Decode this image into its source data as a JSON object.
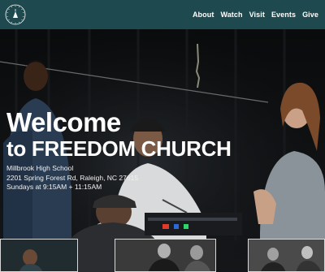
{
  "logo": {
    "icon": "church-logo-icon",
    "ring_text": "FREEDOM CHURCH"
  },
  "nav": {
    "items": [
      {
        "label": "About"
      },
      {
        "label": "Watch"
      },
      {
        "label": "Visit"
      },
      {
        "label": "Events"
      },
      {
        "label": "Give"
      }
    ]
  },
  "hero": {
    "title_line1": "Welcome",
    "title_line2": "to FREEDOM CHURCH",
    "location": "Millbrook High School",
    "address": "2201 Spring Forest Rd, Raleigh, NC 27615",
    "service_times": "Sundays at 9:15AM + 11:15AM"
  },
  "colors": {
    "nav_bg": "#1e4a4f",
    "text": "#ffffff"
  }
}
